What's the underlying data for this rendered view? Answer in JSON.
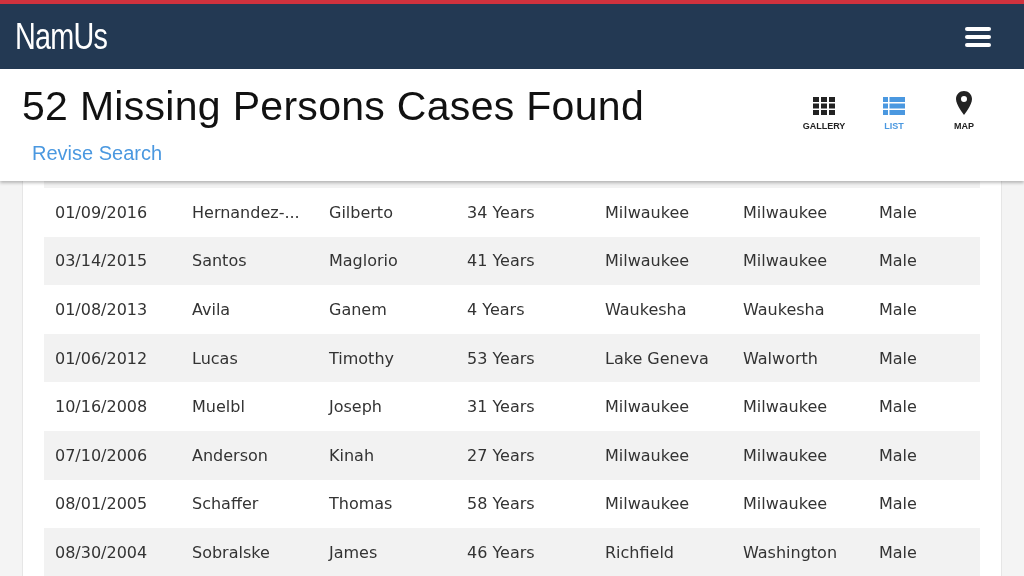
{
  "header": {
    "logo": "NamUs"
  },
  "title": "52 Missing Persons Cases Found",
  "revise_link": "Revise Search",
  "views": [
    {
      "label": "GALLERY",
      "kind": "gallery",
      "selected": false
    },
    {
      "label": "LIST",
      "kind": "list",
      "selected": true
    },
    {
      "label": "MAP",
      "kind": "map",
      "selected": false
    }
  ],
  "rows": [
    [
      "01/09/2016",
      "Hernandez-...",
      "Gilberto",
      "34 Years",
      "Milwaukee",
      "Milwaukee",
      "Male"
    ],
    [
      "03/14/2015",
      "Santos",
      "Maglorio",
      "41 Years",
      "Milwaukee",
      "Milwaukee",
      "Male"
    ],
    [
      "01/08/2013",
      "Avila",
      "Ganem",
      "4 Years",
      "Waukesha",
      "Waukesha",
      "Male"
    ],
    [
      "01/06/2012",
      "Lucas",
      "Timothy",
      "53 Years",
      "Lake Geneva",
      "Walworth",
      "Male"
    ],
    [
      "10/16/2008",
      "Muelbl",
      "Joseph",
      "31 Years",
      "Milwaukee",
      "Milwaukee",
      "Male"
    ],
    [
      "07/10/2006",
      "Anderson",
      "Kinah",
      "27 Years",
      "Milwaukee",
      "Milwaukee",
      "Male"
    ],
    [
      "08/01/2005",
      "Schaffer",
      "Thomas",
      "58 Years",
      "Milwaukee",
      "Milwaukee",
      "Male"
    ],
    [
      "08/30/2004",
      "Sobralske",
      "James",
      "46 Years",
      "Richfield",
      "Washington",
      "Male"
    ]
  ]
}
